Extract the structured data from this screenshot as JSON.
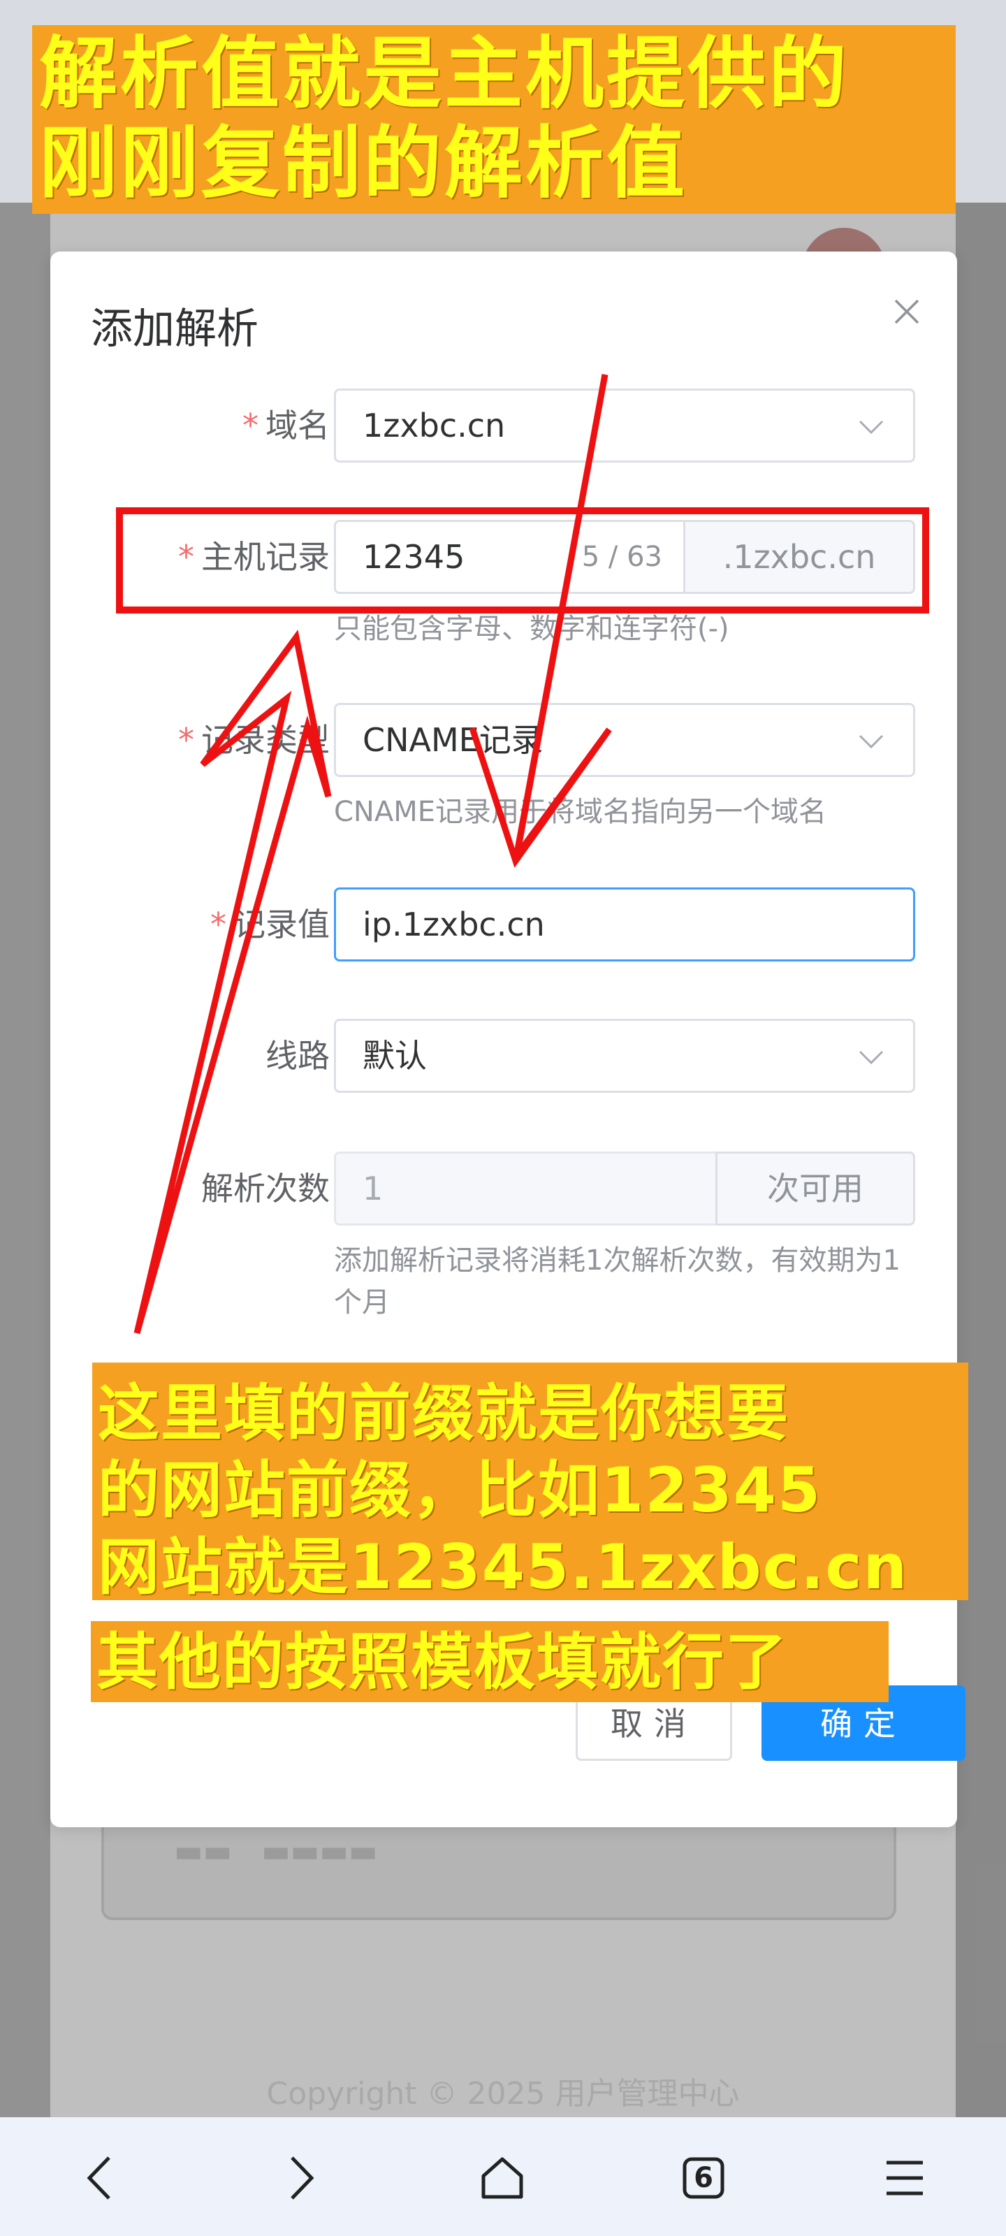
{
  "dialog": {
    "title": "添加解析",
    "fields": {
      "domain": {
        "label": "域名",
        "required": true,
        "value": "1zxbc.cn"
      },
      "host_record": {
        "label": "主机记录",
        "required": true,
        "value": "12345",
        "count": "5 / 63",
        "suffix": ".1zxbc.cn",
        "hint": "只能包含字母、数字和连字符(-)"
      },
      "record_type": {
        "label": "记录类型",
        "required": true,
        "value": "CNAME记录",
        "hint": "CNAME记录用于将域名指向另一个域名"
      },
      "record_value": {
        "label": "记录值",
        "required": true,
        "value": "ip.1zxbc.cn"
      },
      "line": {
        "label": "线路",
        "required": false,
        "value": "默认"
      },
      "parse_count": {
        "label": "解析次数",
        "required": false,
        "value": "1",
        "suffix": "次可用",
        "hint_line1": "添加解析记录将消耗1次解析次数，有效期为1",
        "hint_line2": "个月"
      }
    },
    "buttons": {
      "cancel": "取消",
      "confirm": "确定"
    }
  },
  "annotations": {
    "top_line1": "解析值就是主机提供的",
    "top_line2": "刚刚复制的解析值",
    "mid_line1": "这里填的前缀就是你想要",
    "mid_line2": "的网站前缀，比如12345",
    "mid_line3": "网站就是12345.1zxbc.cn",
    "bottom": "其他的按照模板填就行了"
  },
  "background": {
    "copyright": "Copyright © 2025 用户管理中心"
  },
  "bottom_nav": {
    "tab_count": "6"
  },
  "colors": {
    "primary": "#1890ff",
    "required": "#f56c6c",
    "annotation_bg": "#f5a020",
    "annotation_text": "#ffff1a",
    "arrow_red": "#ee1111"
  }
}
